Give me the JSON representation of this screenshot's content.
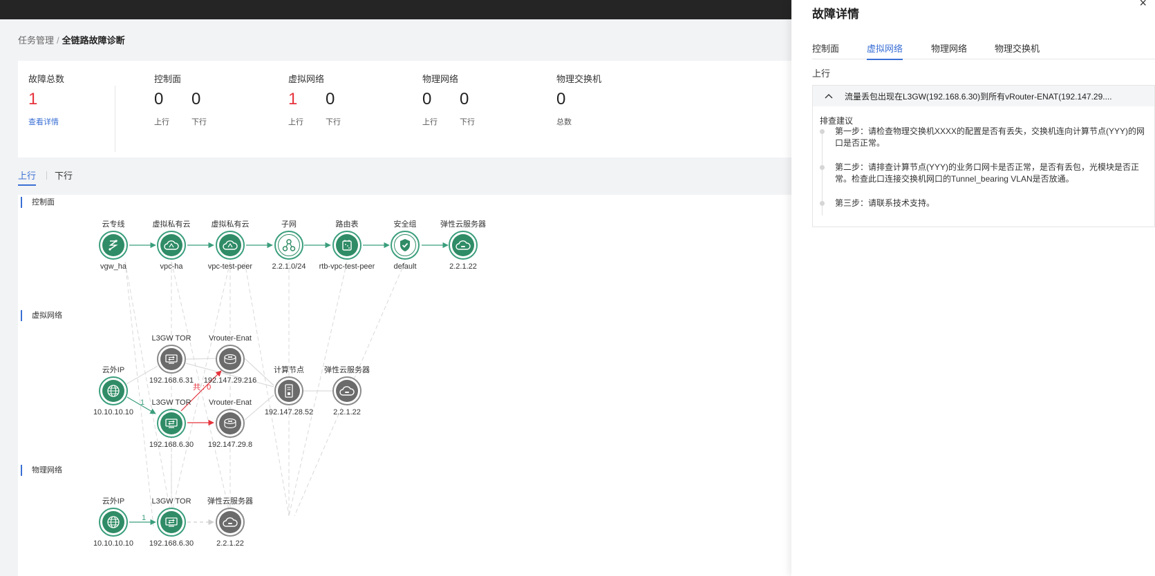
{
  "breadcrumb": {
    "parent": "任务管理",
    "separator": "/",
    "current": "全链路故障诊断"
  },
  "summary": {
    "total": {
      "title": "故障总数",
      "value": "1",
      "link": "查看详情"
    },
    "groups": [
      {
        "title": "控制面",
        "items": [
          {
            "value": "0",
            "label": "上行"
          },
          {
            "value": "0",
            "label": "下行"
          }
        ]
      },
      {
        "title": "虚拟网络",
        "items": [
          {
            "value": "1",
            "label": "上行"
          },
          {
            "value": "0",
            "label": "下行"
          }
        ]
      },
      {
        "title": "物理网络",
        "items": [
          {
            "value": "0",
            "label": "上行"
          },
          {
            "value": "0",
            "label": "下行"
          }
        ]
      },
      {
        "title": "物理交换机",
        "items": [
          {
            "value": "0",
            "label": "总数"
          }
        ]
      }
    ]
  },
  "direction_tabs": {
    "up": "上行",
    "down": "下行",
    "active": "up"
  },
  "topology": {
    "sections": {
      "control": "控制面",
      "virtual": "虚拟网络",
      "physical": "物理网络"
    },
    "control_nodes": [
      {
        "title": "云专线",
        "name": "vgw_ha",
        "icon": "direct-connect-icon"
      },
      {
        "title": "虚拟私有云",
        "name": "vpc-ha",
        "icon": "vpc-cloud-icon"
      },
      {
        "title": "虚拟私有云",
        "name": "vpc-test-peer",
        "icon": "vpc-cloud-icon"
      },
      {
        "title": "子网",
        "name": "2.2.1.0/24",
        "icon": "subnet-icon"
      },
      {
        "title": "路由表",
        "name": "rtb-vpc-test-peer",
        "icon": "route-table-icon"
      },
      {
        "title": "安全组",
        "name": "default",
        "icon": "security-group-icon"
      },
      {
        "title": "弹性云服务器",
        "name": "2.2.1.22",
        "icon": "ecs-cloud-icon"
      }
    ],
    "virtual_nodes": {
      "eip": {
        "title": "云外IP",
        "name": "10.10.10.10"
      },
      "l3gw_top": {
        "title": "L3GW TOR",
        "name": "192.168.6.31"
      },
      "l3gw_bottom": {
        "title": "L3GW TOR",
        "name": "192.168.6.30"
      },
      "vrouter_top": {
        "title": "Vrouter-Enat",
        "name": "192.147.29.216"
      },
      "vrouter_bottom": {
        "title": "Vrouter-Enat",
        "name": "192.147.29.8"
      },
      "compute": {
        "title": "计算节点",
        "name": "192.147.28.52"
      },
      "ecs": {
        "title": "弹性云服务器",
        "name": "2.2.1.22"
      }
    },
    "virtual_edge_labels": {
      "eip_to_l3gw": "1",
      "fault_total": "共 : 0"
    },
    "physical_nodes": {
      "eip": {
        "title": "云外IP",
        "name": "10.10.10.10"
      },
      "l3gw": {
        "title": "L3GW TOR",
        "name": "192.168.6.30"
      },
      "ecs": {
        "title": "弹性云服务器",
        "name": "2.2.1.22"
      }
    },
    "physical_edge_labels": {
      "eip_to_l3gw": "1"
    }
  },
  "panel": {
    "title": "故障详情",
    "tabs": [
      "控制面",
      "虚拟网络",
      "物理网络",
      "物理交换机"
    ],
    "active_tab": "虚拟网络",
    "direction": "上行",
    "fault": "流量丢包出现在L3GW(192.168.6.30)到所有vRouter-ENAT(192.147.29....",
    "advice_title": "排查建议",
    "steps": [
      "第一步：请检查物理交换机XXXX的配置是否有丢失，交换机连向计算节点(YYY)的网口是否正常。",
      "第二步：请排查计算节点(YYY)的业务口网卡是否正常，是否有丢包，光模块是否正常。检查此口连接交换机网口的Tunnel_bearing VLAN是否放通。",
      "第三步：请联系技术支持。"
    ]
  },
  "colors": {
    "accent": "#3a6fd4",
    "fault": "#e6323c",
    "healthy": "#2f8c66",
    "neutral": "#6b6b6b"
  }
}
